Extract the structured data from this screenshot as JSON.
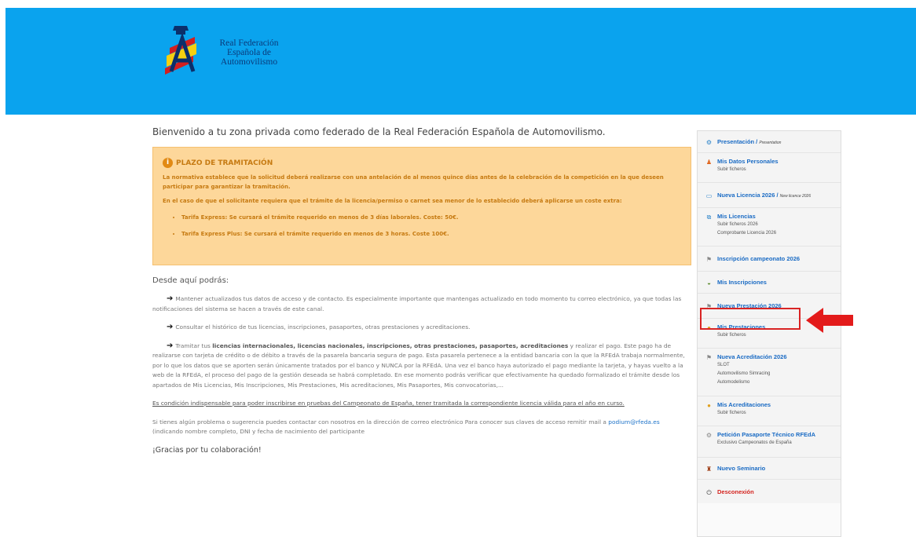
{
  "header": {
    "logo_lines": [
      "Real Federación",
      "Española de",
      "Automovilismo"
    ]
  },
  "welcome": "Bienvenido a tu zona privada como federado de la Real Federación Española de Automovilismo.",
  "alert": {
    "title": "PLAZO DE TRAMITACIÓN",
    "p1": "La normativa establece que la solicitud deberá realizarse con una antelación de al menos quince días antes de la celebración de la competición en la que deseen participar para garantizar la tramitación.",
    "p2": "En el caso de que el solicitante requiera que el trámite de la licencia/permiso o carnet sea menor de lo establecido deberá aplicarse un coste extra:",
    "items": [
      "Tarifa Express: Se cursará el trámite requerido en menos de 3 días laborales. Coste: 50€.",
      "Tarifa Express Plus: Se cursará el trámite requerido en menos de 3 horas. Coste 100€."
    ]
  },
  "content": {
    "desde": "Desde aquí podrás:",
    "bullet1": "Mantener actualizados tus datos de acceso y de contacto. Es especialmente importante que mantengas actualizado en todo momento tu correo electrónico, ya que todas las notificaciones del sistema se hacen a través de este canal.",
    "bullet2": "Consultar el histórico de tus licencias, inscripciones, pasaportes, otras prestaciones y acreditaciones.",
    "bullet3_pre": "Tramitar tus",
    "bullet3_bold": "licencias internacionales, licencias nacionales, inscripciones, otras prestaciones, pasaportes, acreditaciones",
    "bullet3_post": "y realizar el pago. Este pago ha de realizarse con tarjeta de crédito o de débito a través de la pasarela bancaria segura de pago. Esta pasarela pertenece a la entidad bancaria con la que la RFEdA trabaja normalmente, por lo que los datos que se aporten serán únicamente tratados por el banco y NUNCA por la RFEdA. Una vez el banco haya autorizado el pago mediante la tarjeta, y hayas vuelto a la web de la RFEdA, el proceso del pago de la gestión deseada se habrá completado. En ese momento podrás verificar que efectivamente ha quedado formalizado el trámite desde los apartados de Mis Licencias, Mis Inscripciones, Mis Prestaciones, Mis acreditaciones, Mis Pasaportes, Mis convocatorias,...",
    "condicion": "Es condición indispensable para poder inscribirse en pruebas del Campeonato de España, tener tramitada la correspondiente licencia válida para el año en curso.",
    "contacto_pre": "Si tienes algún problema o sugerencia puedes contactar con nosotros en la dirección de correo electrónico Para conocer sus claves de acceso remitir mail a",
    "contacto_email": "podium@rfeda.es",
    "contacto_post": "(indicando nombre completo, DNI y fecha de nacimiento del participante",
    "gracias": "¡Gracias por tu colaboración!"
  },
  "sidebar": {
    "items": [
      {
        "title": "Presentación /",
        "en": "Presentation",
        "subs": []
      },
      {
        "title": "Mis Datos Personales",
        "en": "",
        "subs": [
          "Subir ficheros"
        ]
      },
      {
        "title": "Nueva Licencia 2026 /",
        "en": "New licence 2026",
        "subs": []
      },
      {
        "title": "Mis Licencias",
        "en": "",
        "subs": [
          "Subir ficheros 2026",
          "Comprobante Licencia 2026"
        ]
      },
      {
        "title": "Inscripción campeonato 2026",
        "en": "",
        "subs": []
      },
      {
        "title": "Mis Inscripciones",
        "en": "",
        "subs": []
      },
      {
        "title": "Nueva Prestación 2026",
        "en": "",
        "subs": []
      },
      {
        "title": "Mis Prestaciones",
        "en": "",
        "subs": [
          "Subir ficheros"
        ]
      },
      {
        "title": "Nueva Acreditación 2026",
        "en": "",
        "subs": [
          "SLOT",
          "Automovilismo Simracing",
          "Automodelismo"
        ]
      },
      {
        "title": "Mis Acreditaciones",
        "en": "",
        "subs": [
          "Subir ficheros"
        ]
      },
      {
        "title": "Petición Pasaporte Técnico RFEdA",
        "en": "",
        "subs": [
          "Exclusivo Campeonatos de España"
        ]
      },
      {
        "title": "Nuevo Seminario",
        "en": "",
        "subs": []
      },
      {
        "title": "Desconexión",
        "en": "",
        "subs": []
      }
    ]
  },
  "colors": {
    "banner": "#0aa3ee",
    "alert_bg": "#fdd79a",
    "alert_text": "#c67a11",
    "link": "#1a6bc4",
    "highlight": "#d92424"
  }
}
